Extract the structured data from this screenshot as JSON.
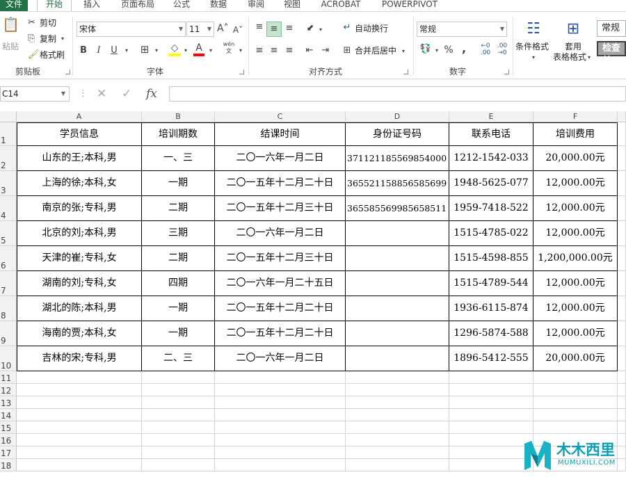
{
  "tabs": [
    {
      "label": "文件"
    },
    {
      "label": "开始"
    },
    {
      "label": "插入"
    },
    {
      "label": "页面布局"
    },
    {
      "label": "公式"
    },
    {
      "label": "数据"
    },
    {
      "label": "审阅"
    },
    {
      "label": "视图"
    },
    {
      "label": "ACROBAT"
    },
    {
      "label": "POWERPIVOT"
    }
  ],
  "ribbon": {
    "clipboard": {
      "paste": "粘贴",
      "cut": "剪切",
      "copy": "复制",
      "format_painter": "格式刷",
      "group": "剪贴板"
    },
    "font": {
      "name": "宋体",
      "size": "11",
      "bold": "B",
      "italic": "I",
      "underline": "U",
      "phonetic": "wén",
      "group": "字体"
    },
    "alignment": {
      "wrap_text": "自动换行",
      "merge_center": "合并后居中",
      "group": "对齐方式"
    },
    "number": {
      "format": "常规",
      "percent": "%",
      "comma": ",",
      "group": "数字"
    },
    "styles": {
      "conditional_format": "条件格式",
      "format_as_table_line1": "套用",
      "format_as_table_line2": "表格格式",
      "style_normal": "常规",
      "style_check": "检查单"
    }
  },
  "formula_bar": {
    "name_box": "C14",
    "fx": "fx",
    "value": ""
  },
  "columns": [
    "A",
    "B",
    "C",
    "D",
    "E",
    "F"
  ],
  "row_numbers": [
    "1",
    "2",
    "3",
    "4",
    "5",
    "6",
    "7",
    "8",
    "9",
    "10",
    "11",
    "12",
    "13",
    "14",
    "15",
    "16",
    "17",
    "18"
  ],
  "headers": [
    "学员信息",
    "培训期数",
    "结课时间",
    "身份证号码",
    "联系电话",
    "培训费用"
  ],
  "rows": [
    [
      "山东的王;本科,男",
      "一、三",
      "二〇一六年一月二日",
      "371121185569854000",
      "1212-1542-033",
      "20,000.00元"
    ],
    [
      "上海的徐;本科,女",
      "一期",
      "二〇一五年十二月二十日",
      "365521158856585699",
      "1948-5625-077",
      "12,000.00元"
    ],
    [
      "南京的张;专科,男",
      "二期",
      "二〇一五年十二月三十日",
      "365585569985658511",
      "1959-7418-522",
      "12,000.00元"
    ],
    [
      "北京的刘;本科,男",
      "三期",
      "二〇一六年一月二日",
      "",
      "1515-4785-022",
      "12,000.00元"
    ],
    [
      "天津的崔;专科,女",
      "二期",
      "二〇一五年十二月三十日",
      "",
      "1515-4598-855",
      "1,200,000.00元"
    ],
    [
      "湖南的刘;专科,女",
      "四期",
      "二〇一六年一月二十五日",
      "",
      "1515-4789-544",
      "12,000.00元"
    ],
    [
      "湖北的陈;本科,男",
      "一期",
      "二〇一五年十二月二十日",
      "",
      "1936-6115-874",
      "12,000.00元"
    ],
    [
      "海南的贾;本科,女",
      "一期",
      "二〇一五年十二月二十日",
      "",
      "1296-5874-588",
      "12,000.00元"
    ],
    [
      "吉林的宋;专科,男",
      "二、三",
      "二〇一六年一月二日",
      "",
      "1896-5412-555",
      "20,000.00元"
    ]
  ],
  "watermark": {
    "text": "木木西里",
    "sub": "MUMUXILI.COM"
  }
}
